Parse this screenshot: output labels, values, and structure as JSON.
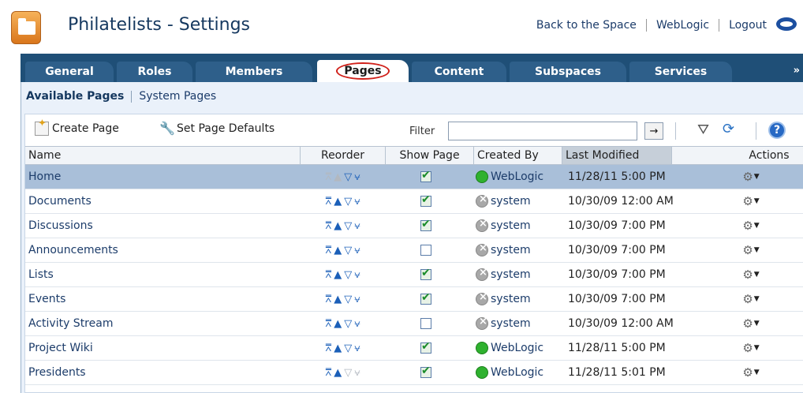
{
  "app": {
    "title": "Philatelists - Settings",
    "links": [
      "Back to the Space",
      "WebLogic",
      "Logout"
    ]
  },
  "tabs": [
    {
      "label": "General",
      "selected": false
    },
    {
      "label": "Roles",
      "selected": false
    },
    {
      "label": "Members",
      "selected": false
    },
    {
      "label": "Pages",
      "selected": true
    },
    {
      "label": "Content",
      "selected": false
    },
    {
      "label": "Subspaces",
      "selected": false
    },
    {
      "label": "Services",
      "selected": false
    }
  ],
  "tab_more": "»",
  "subnav": {
    "active": "Available Pages",
    "other": "System Pages"
  },
  "toolbar": {
    "create_label": "Create Page",
    "defaults_label": "Set Page Defaults",
    "filter_label": "Filter",
    "filter_value": "",
    "go_glyph": "→",
    "help_glyph": "?"
  },
  "columns": {
    "name": "Name",
    "reorder": "Reorder",
    "show": "Show Page",
    "created": "Created By",
    "modified": "Last Modified",
    "actions": "Actions"
  },
  "rows": [
    {
      "name": "Home",
      "show": true,
      "creator": "WebLogic",
      "status": "green",
      "modified": "11/28/11 5:00 PM",
      "selected": true,
      "up_enabled": false,
      "down_enabled": true
    },
    {
      "name": "Documents",
      "show": true,
      "creator": "system",
      "status": "grey",
      "modified": "10/30/09 12:00 AM",
      "selected": false,
      "up_enabled": true,
      "down_enabled": true
    },
    {
      "name": "Discussions",
      "show": true,
      "creator": "system",
      "status": "grey",
      "modified": "10/30/09 7:00 PM",
      "selected": false,
      "up_enabled": true,
      "down_enabled": true
    },
    {
      "name": "Announcements",
      "show": false,
      "creator": "system",
      "status": "grey",
      "modified": "10/30/09 7:00 PM",
      "selected": false,
      "up_enabled": true,
      "down_enabled": true
    },
    {
      "name": "Lists",
      "show": true,
      "creator": "system",
      "status": "grey",
      "modified": "10/30/09 7:00 PM",
      "selected": false,
      "up_enabled": true,
      "down_enabled": true
    },
    {
      "name": "Events",
      "show": true,
      "creator": "system",
      "status": "grey",
      "modified": "10/30/09 7:00 PM",
      "selected": false,
      "up_enabled": true,
      "down_enabled": true
    },
    {
      "name": "Activity Stream",
      "show": false,
      "creator": "system",
      "status": "grey",
      "modified": "10/30/09 12:00 AM",
      "selected": false,
      "up_enabled": true,
      "down_enabled": true
    },
    {
      "name": "Project Wiki",
      "show": true,
      "creator": "WebLogic",
      "status": "green",
      "modified": "11/28/11 5:00 PM",
      "selected": false,
      "up_enabled": true,
      "down_enabled": true
    },
    {
      "name": "Presidents",
      "show": true,
      "creator": "WebLogic",
      "status": "green",
      "modified": "11/28/11 5:01 PM",
      "selected": false,
      "up_enabled": true,
      "down_enabled": false
    }
  ],
  "icons": {
    "app": "folder-icon",
    "oracle": "oracle-logo-icon",
    "create": "create-page-icon",
    "defaults": "wrench-icon",
    "filter": "funnel-icon",
    "refresh": "refresh-icon",
    "help": "help-icon",
    "actions": "gear-icon"
  },
  "colors": {
    "tab_bar": "#1f4f77",
    "selected_row": "#a9bfd9",
    "selected_tab_circle": "#d0201a",
    "link": "#1c3c6a"
  }
}
